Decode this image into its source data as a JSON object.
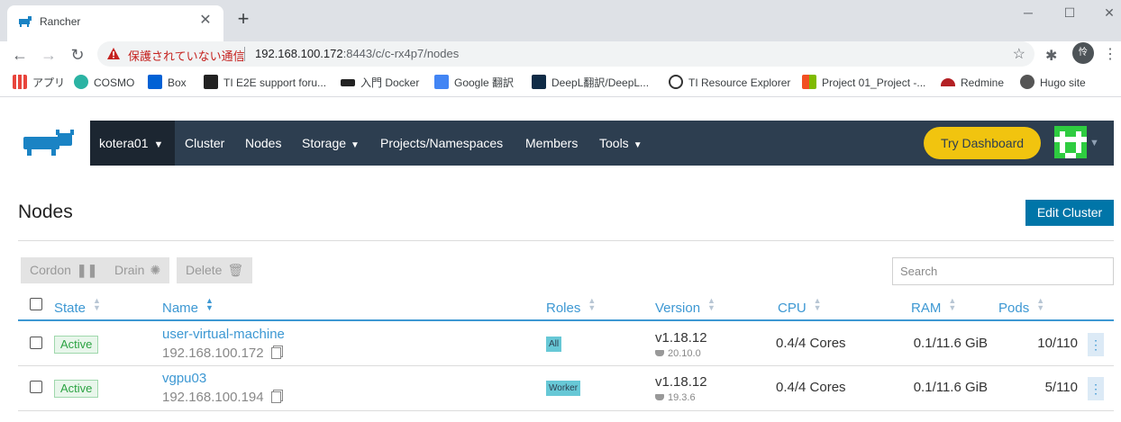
{
  "browser": {
    "tab_title": "Rancher",
    "close_glyph": "✕",
    "newtab_glyph": "+",
    "window_controls": {
      "minimize": "─",
      "maximize": "☐",
      "close": "✕"
    },
    "back_glyph": "←",
    "forward_glyph": "→",
    "reload_glyph": "↻",
    "security_warning": "保護されていない通信",
    "url_host": "192.168.100.172",
    "url_rest": ":8443/c/c-rx4p7/nodes",
    "star_glyph": "☆",
    "extensions_glyph": "✱",
    "profile_initial": "怜",
    "menu_glyph": "⋮"
  },
  "bookmarks": [
    {
      "label": "アプリ",
      "icon": "apps-grid-icon",
      "color": "#e8453c"
    },
    {
      "label": "COSMO",
      "icon": "cosmo-icon",
      "color": "#2bb3a3"
    },
    {
      "label": "Box",
      "icon": "box-icon",
      "color": "#0061d5"
    },
    {
      "label": "TI E2E support foru...",
      "icon": "ti-icon",
      "color": "#222222"
    },
    {
      "label": "入門 Docker",
      "icon": "graduation-cap-icon",
      "color": "#222222"
    },
    {
      "label": "Google 翻訳",
      "icon": "google-translate-icon",
      "color": "#4285f4"
    },
    {
      "label": "DeepL翻訳/DeepL...",
      "icon": "deepl-icon",
      "color": "#0f2b46"
    },
    {
      "label": "TI Resource Explorer",
      "icon": "compass-icon",
      "color": "#333333"
    },
    {
      "label": "Project 01_Project -...",
      "icon": "microsoft-icon",
      "color": "#f25022"
    },
    {
      "label": "Redmine",
      "icon": "redmine-icon",
      "color": "#b32024"
    },
    {
      "label": "Hugo site",
      "icon": "globe-icon",
      "color": "#555555"
    }
  ],
  "rancher_nav": {
    "cluster": "kotera01",
    "caret": "⌄",
    "items": [
      "Cluster",
      "Nodes",
      "Storage",
      "Projects/Namespaces",
      "Members",
      "Tools"
    ],
    "try_dashboard": "Try Dashboard",
    "brand_color": "#2d3e50"
  },
  "page": {
    "title": "Nodes",
    "edit_cluster": "Edit Cluster"
  },
  "actions": {
    "cordon": "Cordon",
    "drain": "Drain",
    "delete": "Delete",
    "search_placeholder": "Search"
  },
  "table": {
    "headers": {
      "state": "State",
      "name": "Name",
      "roles": "Roles",
      "version": "Version",
      "cpu": "CPU",
      "ram": "RAM",
      "pods": "Pods"
    },
    "sort_glyph": "⌃⌄",
    "rows": [
      {
        "state": "Active",
        "name": "user-virtual-machine",
        "ip": "192.168.100.172",
        "role": "All",
        "version": "v1.18.12",
        "docker": "20.10.0",
        "cpu": "0.4/4 Cores",
        "ram": "0.1/11.6 GiB",
        "pods": "10/110",
        "kebab": "⋮"
      },
      {
        "state": "Active",
        "name": "vgpu03",
        "ip": "192.168.100.194",
        "role": "Worker",
        "version": "v1.18.12",
        "docker": "19.3.6",
        "cpu": "0.4/4 Cores",
        "ram": "0.1/11.6 GiB",
        "pods": "5/110",
        "kebab": "⋮"
      }
    ]
  }
}
